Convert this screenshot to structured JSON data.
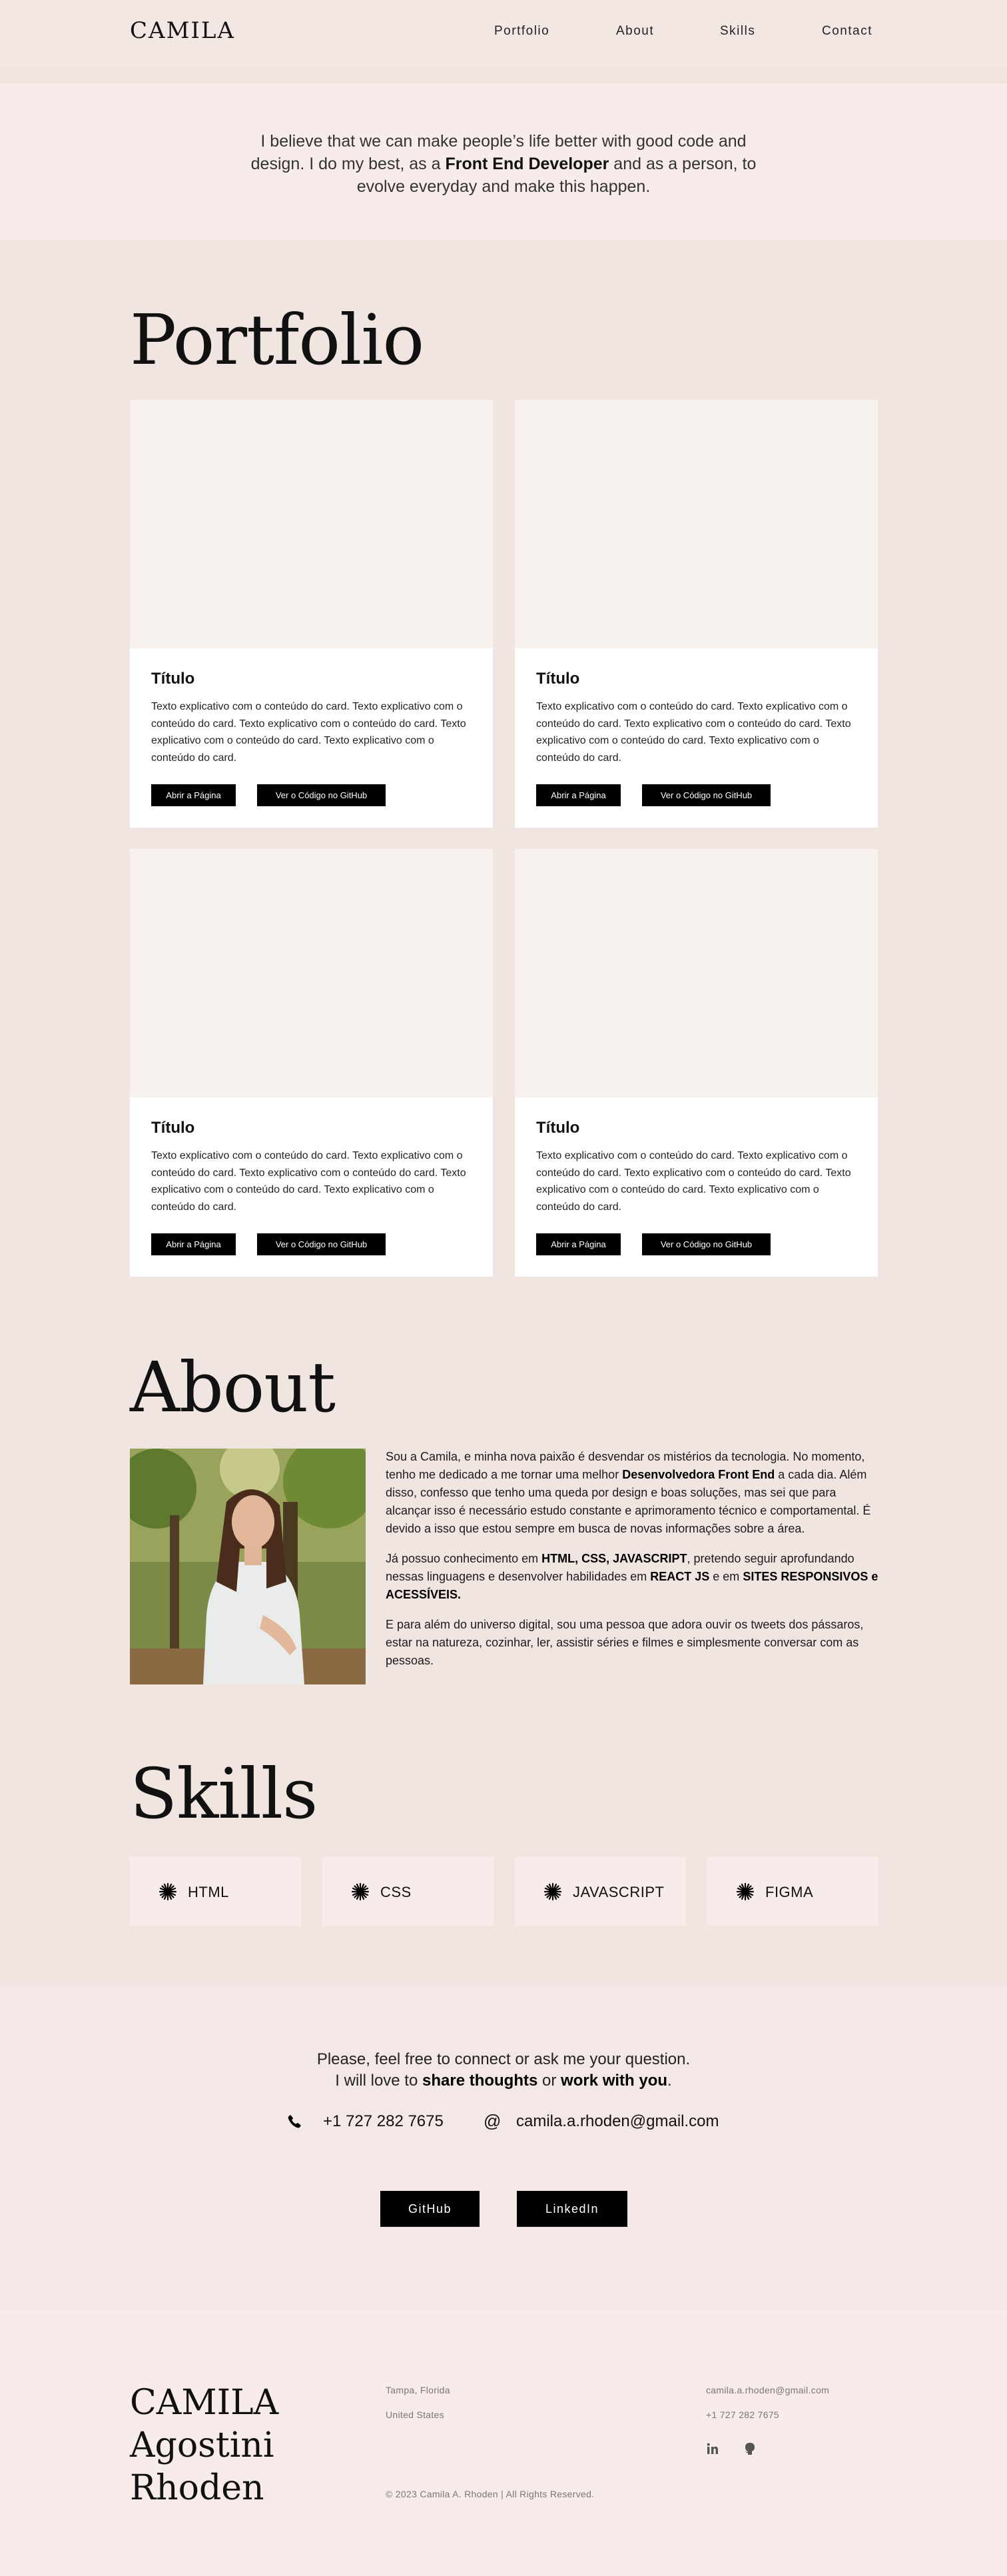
{
  "header": {
    "logo": "CAMILA",
    "nav": [
      "Portfolio",
      "About",
      "Skills",
      "Contact"
    ]
  },
  "hero": {
    "text_1": "I believe that we can make people’s life better with good code and design. I do my best, as a ",
    "highlight": "Front End Developer",
    "text_2": " and as a person, to evolve everyday and make this happen."
  },
  "portfolio": {
    "title": "Portfolio",
    "cards": [
      {
        "title": "Título",
        "text": "Texto explicativo com o conteúdo do card. Texto explicativo com o conteúdo do card. Texto explicativo com o conteúdo do card. Texto explicativo com o conteúdo do card. Texto explicativo com o conteúdo do card.",
        "page_button": "Abrir a Página",
        "github_button": "Ver o Código no GitHub"
      },
      {
        "title": "Título",
        "text": "Texto explicativo com o conteúdo do card. Texto explicativo com o conteúdo do card. Texto explicativo com o conteúdo do card. Texto explicativo com o conteúdo do card. Texto explicativo com o conteúdo do card.",
        "page_button": "Abrir a Página",
        "github_button": "Ver o Código no GitHub"
      },
      {
        "title": "Título",
        "text": "Texto explicativo com o conteúdo do card. Texto explicativo com o conteúdo do card. Texto explicativo com o conteúdo do card. Texto explicativo com o conteúdo do card. Texto explicativo com o conteúdo do card.",
        "page_button": "Abrir a Página",
        "github_button": "Ver o Código no GitHub"
      },
      {
        "title": "Título",
        "text": "Texto explicativo com o conteúdo do card. Texto explicativo com o conteúdo do card. Texto explicativo com o conteúdo do card. Texto explicativo com o conteúdo do card. Texto explicativo com o conteúdo do card.",
        "page_button": "Abrir a Página",
        "github_button": "Ver o Código no GitHub"
      }
    ]
  },
  "about": {
    "title": "About",
    "p1_a": "Sou a Camila, e minha nova paixão é desvendar os mistérios da tecnologia. No momento, tenho me dedicado a me tornar uma melhor ",
    "p1_b": "Desenvolvedora Front End",
    "p1_c": " a cada dia. Além disso, confesso que tenho uma queda por design e boas soluções, mas sei que para alcançar isso é necessário estudo constante e aprimoramento técnico e comportamental. É devido a isso que estou sempre em busca de novas informações sobre a área.",
    "p2_a": "Já possuo conhecimento em ",
    "p2_b": "HTML, CSS, JAVASCRIPT",
    "p2_c": ", pretendo seguir aprofundando nessas linguagens e desenvolver habilidades em ",
    "p2_d": "REACT JS",
    "p2_e": " e em ",
    "p2_f": "SITES RESPONSIVOS e ACESSÍVEIS.",
    "p3": "E para além do universo digital, sou uma pessoa que adora ouvir os tweets dos pássaros, estar na natureza, cozinhar, ler, assistir séries e filmes e simplesmente conversar com as pessoas."
  },
  "skills": {
    "title": "Skills",
    "items": [
      "HTML",
      "CSS",
      "JAVASCRIPT",
      "FIGMA"
    ]
  },
  "contact": {
    "line1": "Please, feel free to connect or ask me your question.",
    "line2_a": "I will love to ",
    "line2_b": "share thoughts",
    "line2_c": " or ",
    "line2_d": "work with you",
    "line2_e": ".",
    "phone": "+1 727 282 7675",
    "email": "camila.a.rhoden@gmail.com",
    "github_button": "GitHub",
    "linkedin_button": "LinkedIn"
  },
  "footer": {
    "name_lines": [
      "CAMILA",
      "Agostini",
      "Rhoden"
    ],
    "city": "Tampa, Florida",
    "country": "United States",
    "email": "camila.a.rhoden@gmail.com",
    "phone": "+1 727 282 7675",
    "copyright": "© 2023 Camila A. Rhoden | All Rights Reserved."
  },
  "icons": [
    "phone-icon",
    "at-icon",
    "linkedin-icon",
    "github-icon",
    "starburst-icon"
  ],
  "colors": {
    "background": "#f1e5e1",
    "hero_band": "#f7ecea",
    "button": "#000000",
    "card": "#ffffff"
  }
}
